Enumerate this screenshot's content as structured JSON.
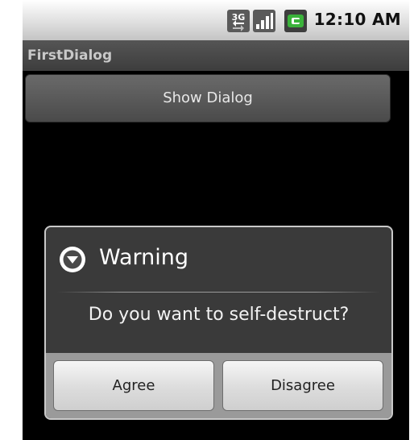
{
  "status_bar": {
    "network_badge": "3G",
    "time": "12:10 AM",
    "icons": [
      "3g-icon",
      "signal-icon",
      "battery-charging-icon"
    ]
  },
  "app": {
    "title": "FirstDialog",
    "show_dialog_label": "Show Dialog"
  },
  "dialog": {
    "icon": "warning-icon",
    "title": "Warning",
    "message": "Do you want to self-destruct?",
    "buttons": {
      "agree": "Agree",
      "disagree": "Disagree"
    }
  },
  "colors": {
    "screen_bg": "#000000",
    "title_bar": "#4a4a4a",
    "dialog_bg": "#3a3a3a",
    "button_bar": "#9a9a9a",
    "battery_green": "#3bb33b"
  }
}
